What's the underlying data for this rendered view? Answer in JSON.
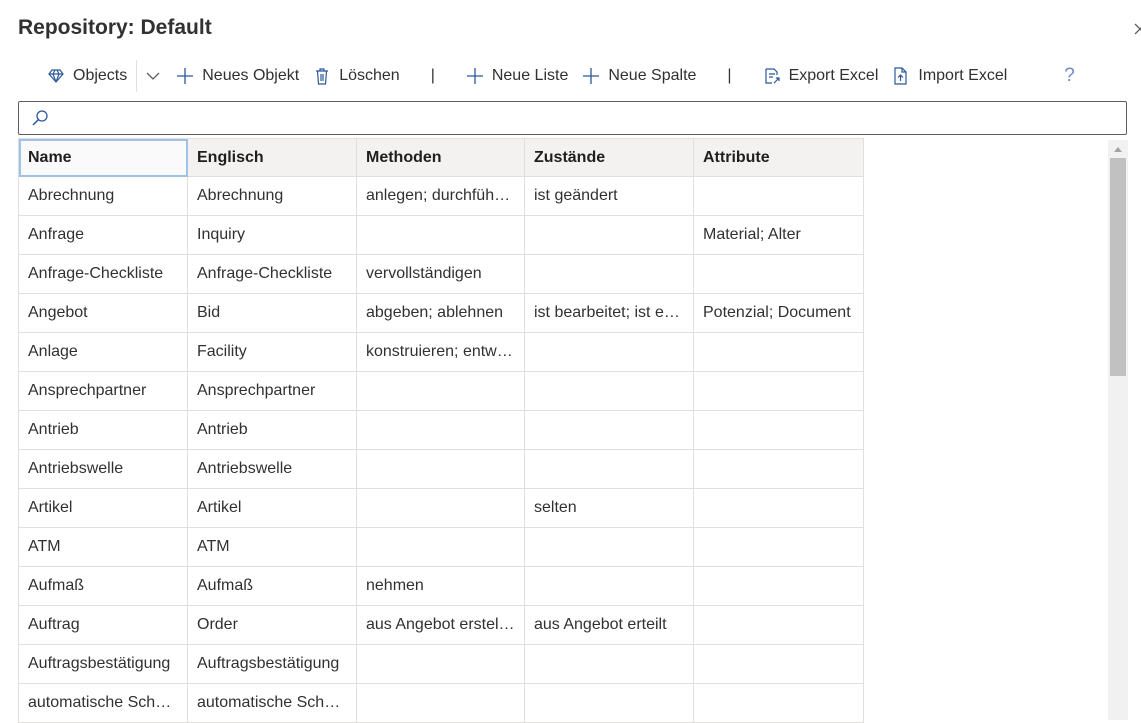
{
  "header": {
    "title": "Repository: Default"
  },
  "toolbar": {
    "objects_label": "Objects",
    "new_object_label": "Neues Objekt",
    "delete_label": "Löschen",
    "separator": "|",
    "new_list_label": "Neue Liste",
    "new_column_label": "Neue Spalte",
    "export_label": "Export Excel",
    "import_label": "Import Excel",
    "help_label": "?"
  },
  "search": {
    "value": "",
    "placeholder": ""
  },
  "table": {
    "columns": [
      "Name",
      "Englisch",
      "Methoden",
      "Zustände",
      "Attribute"
    ],
    "rows": [
      [
        "Abrechnung",
        "Abrechnung",
        "anlegen; durchführen",
        "ist geändert",
        ""
      ],
      [
        "Anfrage",
        "Inquiry",
        "",
        "",
        "Material; Alter"
      ],
      [
        "Anfrage-Checkliste",
        "Anfrage-Checkliste",
        "vervollständigen",
        "",
        ""
      ],
      [
        "Angebot",
        "Bid",
        "abgeben; ablehnen",
        "ist bearbeitet; ist erstellt",
        "Potenzial; Document"
      ],
      [
        "Anlage",
        "Facility",
        "konstruieren; entwickeln",
        "",
        ""
      ],
      [
        "Ansprechpartner",
        "Ansprechpartner",
        "",
        "",
        ""
      ],
      [
        "Antrieb",
        "Antrieb",
        "",
        "",
        ""
      ],
      [
        "Antriebswelle",
        "Antriebswelle",
        "",
        "",
        ""
      ],
      [
        "Artikel",
        "Artikel",
        "",
        "selten",
        ""
      ],
      [
        "ATM",
        "ATM",
        "",
        "",
        ""
      ],
      [
        "Aufmaß",
        "Aufmaß",
        "nehmen",
        "",
        ""
      ],
      [
        "Auftrag",
        "Order",
        "aus Angebot erstellen",
        "aus Angebot erteilt",
        ""
      ],
      [
        "Auftragsbestätigung",
        "Auftragsbestätigung",
        "",
        "",
        ""
      ],
      [
        "automatische Schaltung",
        "automatische Schaltung",
        "",
        "",
        ""
      ]
    ]
  },
  "colors": {
    "accent": "#2b579a",
    "border": "#e1dfdd",
    "header_bg": "#f3f2f1"
  }
}
